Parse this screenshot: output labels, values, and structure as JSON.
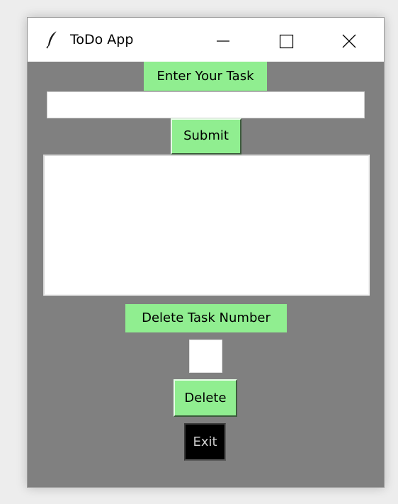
{
  "window": {
    "title": "ToDo App",
    "background_color": "#808080",
    "accent_color": "#90ee90",
    "controls": {
      "minimize_icon": "minimize-icon",
      "maximize_icon": "maximize-icon",
      "close_icon": "close-icon"
    },
    "app_icon": "feather-icon"
  },
  "form": {
    "task_label": "Enter Your Task",
    "task_input_value": "",
    "submit_label": "Submit",
    "delete_label": "Delete Task Number",
    "delete_number_value": "",
    "delete_button_label": "Delete",
    "exit_label": "Exit"
  },
  "task_list": {
    "items": []
  }
}
